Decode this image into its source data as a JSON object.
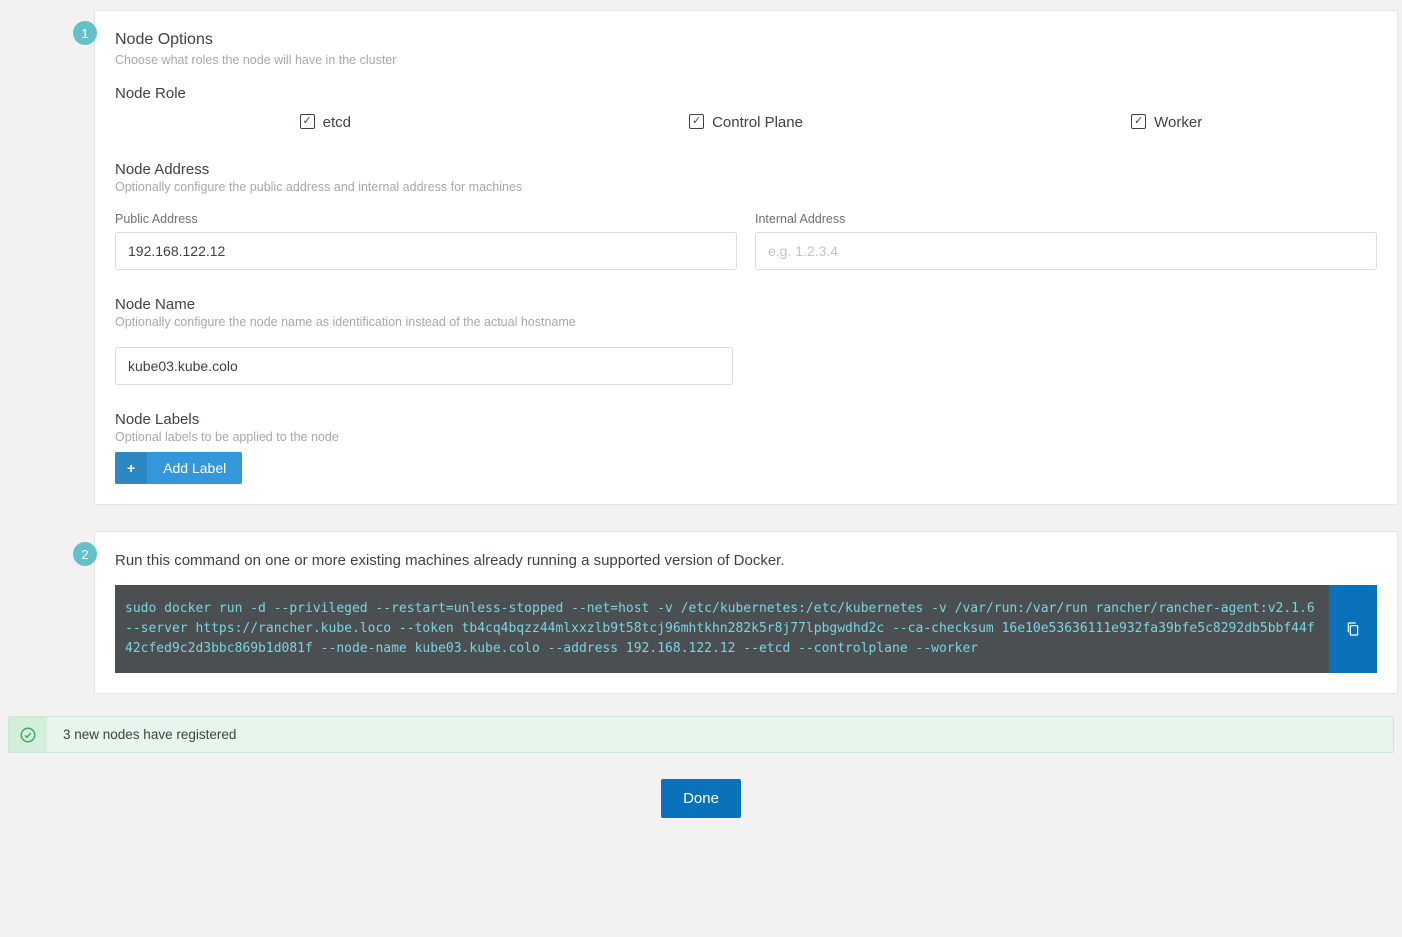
{
  "step1": {
    "badge": "1",
    "title": "Node Options",
    "subtitle": "Choose what roles the node will have in the cluster",
    "role_heading": "Node Role",
    "roles": {
      "etcd": "etcd",
      "control_plane": "Control Plane",
      "worker": "Worker"
    },
    "address": {
      "heading": "Node Address",
      "sub": "Optionally configure the public address and internal address for machines",
      "public_label": "Public Address",
      "public_value": "192.168.122.12",
      "internal_label": "Internal Address",
      "internal_placeholder": "e.g. 1.2.3.4"
    },
    "name": {
      "heading": "Node Name",
      "sub": "Optionally configure the node name as identification instead of the actual hostname",
      "value": "kube03.kube.colo"
    },
    "labels": {
      "heading": "Node Labels",
      "sub": "Optional labels to be applied to the node",
      "add_btn": "Add Label"
    }
  },
  "step2": {
    "badge": "2",
    "text": "Run this command on one or more existing machines already running a supported version of Docker.",
    "command": "sudo docker run -d --privileged --restart=unless-stopped --net=host -v /etc/kubernetes:/etc/kubernetes -v /var/run:/var/run rancher/rancher-agent:v2.1.6 --server https://rancher.kube.loco --token tb4cq4bqzz44mlxxzlb9t58tcj96mhtkhn282k5r8j77lpbgwdhd2c --ca-checksum 16e10e53636111e932fa39bfe5c8292db5bbf44f42cfed9c2d3bbc869b1d081f --node-name kube03.kube.colo --address 192.168.122.12 --etcd --controlplane --worker"
  },
  "status": "3 new nodes have registered",
  "done": "Done"
}
